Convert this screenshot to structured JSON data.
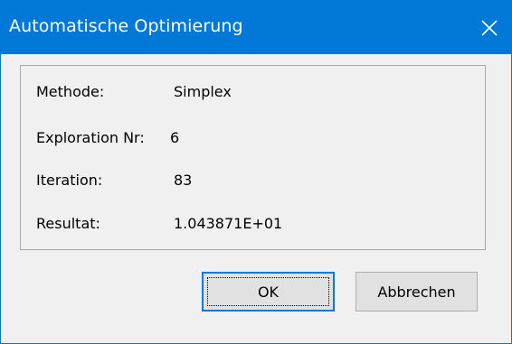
{
  "window": {
    "title": "Automatische Optimierung"
  },
  "info": {
    "rows": [
      {
        "label": "Methode:",
        "value": "Simplex"
      },
      {
        "label": "Exploration Nr:",
        "value": "6"
      },
      {
        "label": "Iteration:",
        "value": "83"
      },
      {
        "label": "Resultat:",
        "value": "1.043871E+01"
      }
    ]
  },
  "buttons": {
    "ok_label": "OK",
    "cancel_label": "Abbrechen"
  },
  "colors": {
    "titlebar": "#0078d7",
    "focus_border": "#0078d7"
  },
  "icons": {
    "close": "close-icon"
  }
}
